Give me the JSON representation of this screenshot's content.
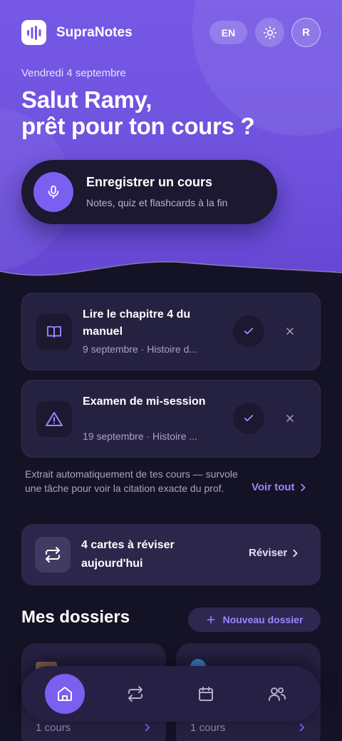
{
  "app": {
    "brand": "SupraNotes",
    "lang": "EN",
    "avatar_initial": "R"
  },
  "hero": {
    "date": "Vendredi 4 septembre",
    "greeting_line1": "Salut Ramy,",
    "greeting_line2": "prêt pour ton cours ?"
  },
  "record": {
    "title": "Enregistrer un cours",
    "subtitle": "Notes, quiz et flashcards à la fin"
  },
  "tasks": [
    {
      "title": "Lire le chapitre 4 du manuel",
      "meta": "9 septembre · Histoire d...",
      "icon": "book-icon"
    },
    {
      "title": "Examen de mi-session",
      "meta": "19 septembre · Histoire ...",
      "icon": "warning-icon"
    }
  ],
  "tasks_note": "Extrait automatiquement de tes cours — survole une tâche pour voir la citation exacte du prof.",
  "see_all": "Voir tout",
  "review": {
    "title": "4 cartes à réviser aujourd'hui",
    "action": "Réviser"
  },
  "folders": {
    "title": "Mes dossiers",
    "new_button": "Nouveau dossier",
    "items": [
      {
        "count": "1 cours"
      },
      {
        "count": "1 cours"
      }
    ]
  },
  "nav": [
    "home-icon",
    "repeat-icon",
    "calendar-icon",
    "users-icon"
  ],
  "colors": {
    "accent": "#7b5ff0",
    "accent_text": "#9b86ff",
    "background": "#141225",
    "card": "#252140"
  }
}
